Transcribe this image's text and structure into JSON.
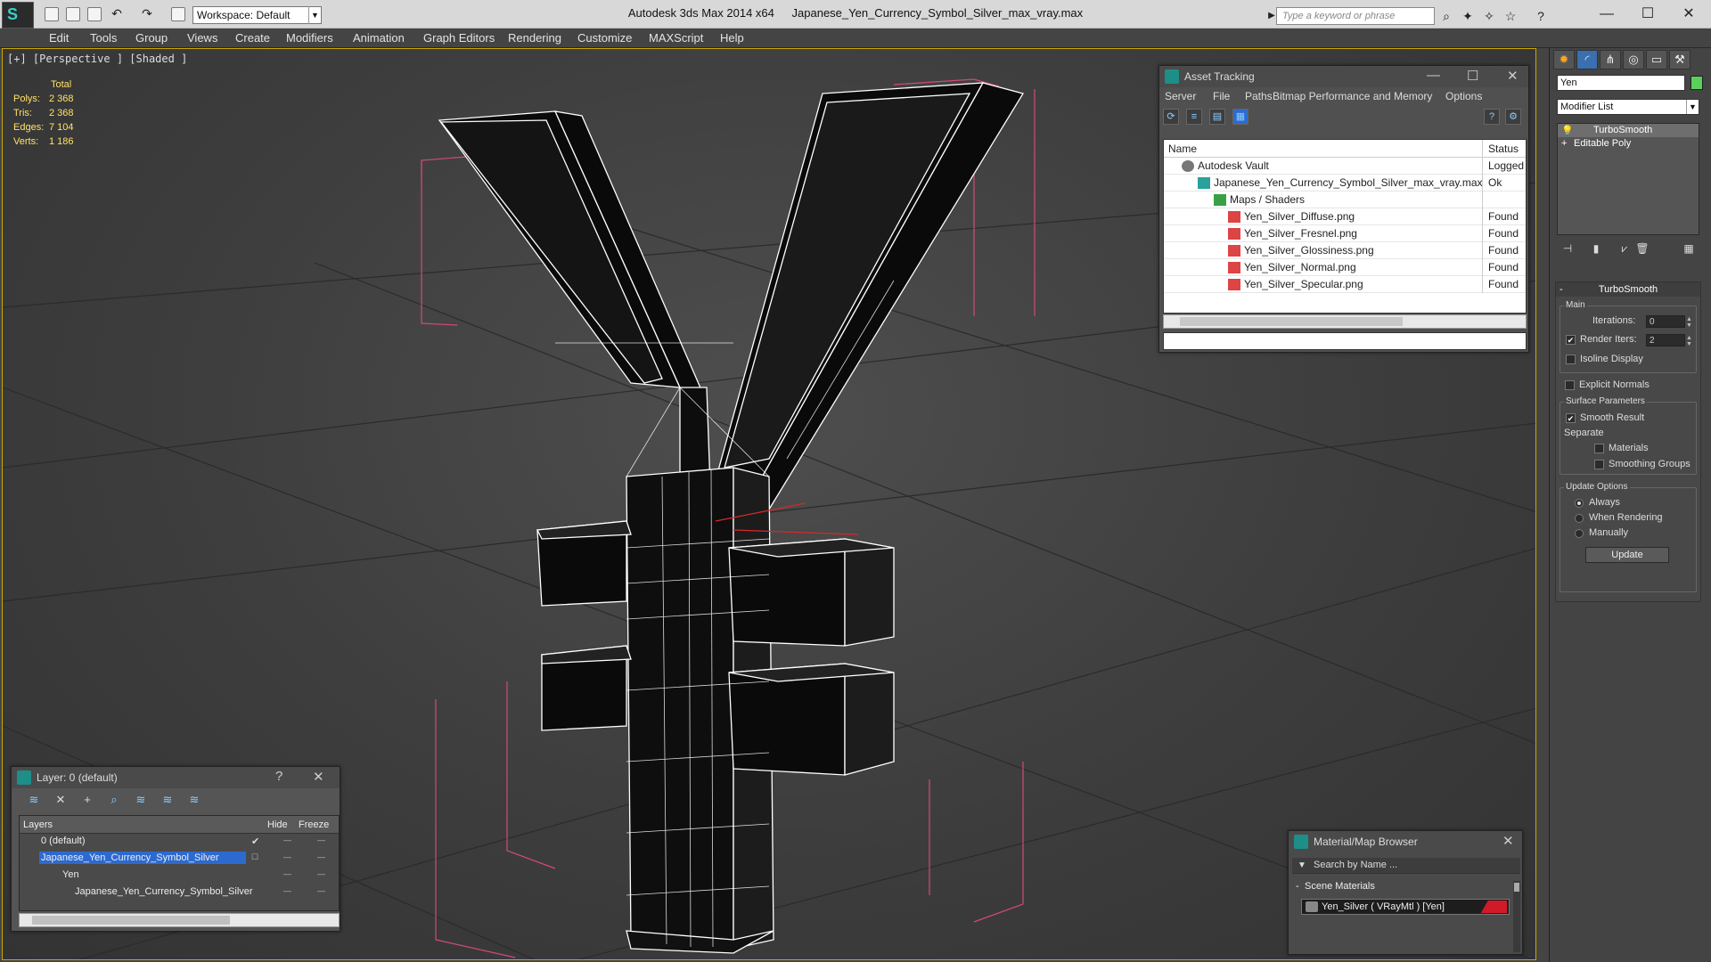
{
  "titlebar": {
    "workspace": "Workspace: Default",
    "app_title": "Autodesk 3ds Max  2014 x64",
    "file_title": "Japanese_Yen_Currency_Symbol_Silver_max_vray.max",
    "search_placeholder": "Type a keyword or phrase"
  },
  "menu": [
    "Edit",
    "Tools",
    "Group",
    "Views",
    "Create",
    "Modifiers",
    "Animation",
    "Graph Editors",
    "Rendering",
    "Customize",
    "MAXScript",
    "Help"
  ],
  "viewport": {
    "label": "[+] [Perspective ] [Shaded ]",
    "stats": {
      "header": "Total",
      "rows": [
        {
          "label": "Polys:",
          "value": "2 368"
        },
        {
          "label": "Tris:",
          "value": "2 368"
        },
        {
          "label": "Edges:",
          "value": "7 104"
        },
        {
          "label": "Verts:",
          "value": "1 186"
        }
      ]
    },
    "colors": {
      "wire": "#ffffff",
      "bbox": "#d24a78",
      "grid": "#2a2a2a",
      "border": "#c8a800"
    }
  },
  "asset_tracking": {
    "title": "Asset Tracking",
    "menu": [
      "Server",
      "File",
      "Paths",
      "Bitmap Performance and Memory",
      "Options"
    ],
    "columns": {
      "name": "Name",
      "status": "Status"
    },
    "rows": [
      {
        "name": "Autodesk Vault",
        "status": "Logged Out",
        "indent": 0,
        "icon": "vault-icon"
      },
      {
        "name": "Japanese_Yen_Currency_Symbol_Silver_max_vray.max",
        "status": "Ok",
        "indent": 1,
        "icon": "max-file-icon"
      },
      {
        "name": "Maps / Shaders",
        "status": "",
        "indent": 2,
        "icon": "maps-icon"
      },
      {
        "name": "Yen_Silver_Diffuse.png",
        "status": "Found",
        "indent": 3,
        "icon": "png-icon"
      },
      {
        "name": "Yen_Silver_Fresnel.png",
        "status": "Found",
        "indent": 3,
        "icon": "png-icon"
      },
      {
        "name": "Yen_Silver_Glossiness.png",
        "status": "Found",
        "indent": 3,
        "icon": "png-icon"
      },
      {
        "name": "Yen_Silver_Normal.png",
        "status": "Found",
        "indent": 3,
        "icon": "png-icon"
      },
      {
        "name": "Yen_Silver_Specular.png",
        "status": "Found",
        "indent": 3,
        "icon": "png-icon"
      }
    ]
  },
  "command_panel": {
    "object_name": "Yen",
    "object_color": "#5ad05a",
    "modifier_list": "Modifier List",
    "stack": [
      "TurboSmooth",
      "Editable Poly"
    ],
    "turbosmooth": {
      "title": "TurboSmooth",
      "main_label": "Main",
      "iterations_label": "Iterations:",
      "iterations": "0",
      "render_iters_label": "Render Iters:",
      "render_iters": "2",
      "isoline": "Isoline Display",
      "explicit_normals": "Explicit Normals",
      "surface_params": "Surface Parameters",
      "smooth_result": "Smooth Result",
      "separate": "Separate",
      "materials": "Materials",
      "smoothing_groups": "Smoothing Groups",
      "update_options": "Update Options",
      "always": "Always",
      "when_rendering": "When Rendering",
      "manually": "Manually",
      "update_button": "Update"
    }
  },
  "layer_window": {
    "title": "Layer: 0 (default)",
    "columns": {
      "layers": "Layers",
      "hide": "Hide",
      "freeze": "Freeze"
    },
    "rows": [
      {
        "name": "0 (default)",
        "indent": 0
      },
      {
        "name": "Japanese_Yen_Currency_Symbol_Silver",
        "indent": 0
      },
      {
        "name": "Yen",
        "indent": 1
      },
      {
        "name": "Japanese_Yen_Currency_Symbol_Silver",
        "indent": 1
      }
    ]
  },
  "material_browser": {
    "title": "Material/Map Browser",
    "search_placeholder": "Search by Name ...",
    "group": "Scene Materials",
    "item": "Yen_Silver  ( VRayMtl )  [Yen]"
  }
}
